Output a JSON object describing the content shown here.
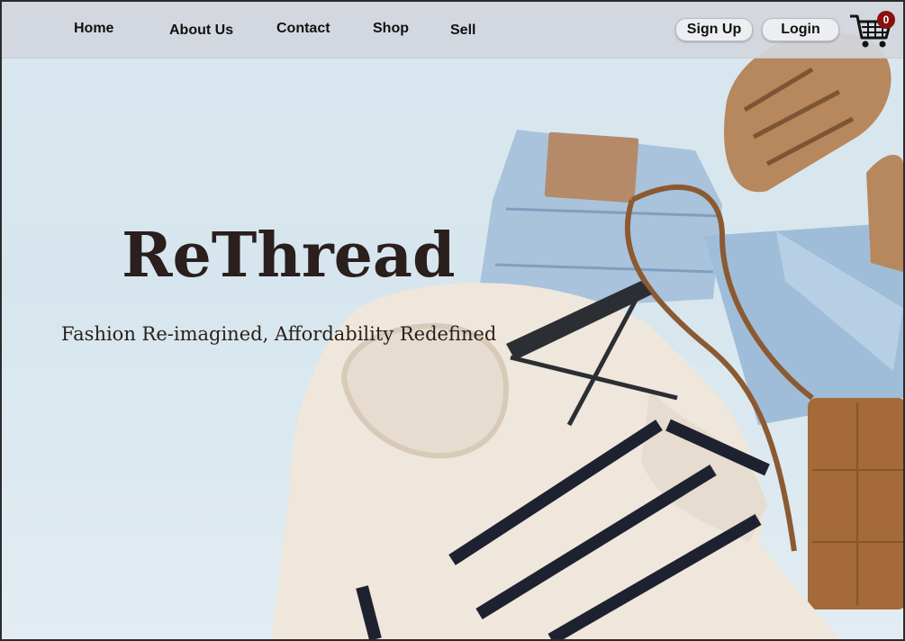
{
  "nav": {
    "links": [
      "Home",
      "About Us",
      "Contact",
      "Shop",
      "Sell"
    ],
    "signup_label": "Sign Up",
    "login_label": "Login",
    "cart_icon": "shopping-cart-icon",
    "cart_count": "0"
  },
  "hero": {
    "brand": "ReThread",
    "tagline": "Fashion Re-imagined, Affordability Redefined"
  },
  "colors": {
    "navbar": "#d2d7de",
    "badge": "#8a0f0f",
    "text_dark": "#2a1f1c",
    "background": "#d9e7ef"
  }
}
